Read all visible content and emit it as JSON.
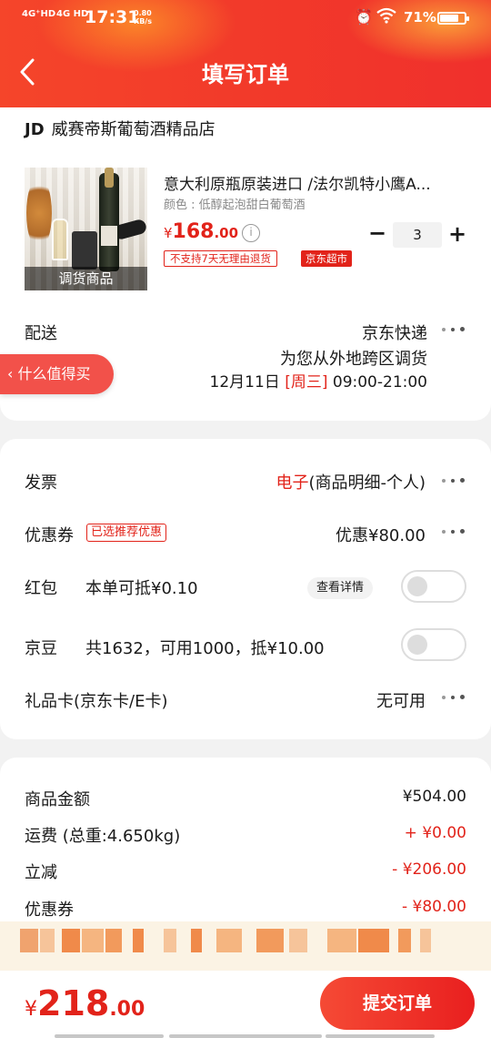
{
  "status_bar": {
    "signal1": "4G⁺HD",
    "signal2": "4G HD",
    "time": "17:31",
    "speed_value": "0.80",
    "speed_unit": "KB/s",
    "battery": "71%"
  },
  "header": {
    "title": "填写订单"
  },
  "shop": {
    "logo": "JD",
    "name": "威赛帝斯葡萄酒精品店"
  },
  "product": {
    "name": "意大利原瓶原装进口 /法尔凯特小鹰A...",
    "spec": "颜色 : 低醇起泡甜白葡萄酒",
    "image_badge": "调货商品",
    "price_currency": "¥",
    "price_int": "168",
    "price_dec": ".00",
    "info_icon": "i",
    "tag_norefund": "不支持7天无理由退货",
    "tag_super": "京东超市",
    "qty_minus": "−",
    "quantity": "3",
    "qty_plus": "+"
  },
  "delivery": {
    "label": "配送",
    "method": "京东快递",
    "note": "为您从外地跨区调货",
    "date": "12月11日 ",
    "weekday": "[周三]",
    "time_range": " 09:00-21:00"
  },
  "float_button": {
    "label": "什么值得买"
  },
  "invoice": {
    "label": "发票",
    "type": "电子",
    "detail": "(商品明细-个人)"
  },
  "coupon": {
    "label": "优惠券",
    "tag": "已选推荐优惠",
    "value": "优惠¥80.00"
  },
  "red_packet": {
    "label": "红包",
    "text": "本单可抵¥0.10",
    "detail_button": "查看详情"
  },
  "jd_beans": {
    "label": "京豆",
    "text": "共1632，可用1000，抵¥10.00"
  },
  "gift_card": {
    "label": "礼品卡(京东卡/E卡)",
    "value": "无可用"
  },
  "summary": {
    "goods_label": "商品金额",
    "goods_value": "¥504.00",
    "shipping_label": "运费 (总重:4.650kg)",
    "shipping_value": "+ ¥0.00",
    "discount_label": "立减",
    "discount_value": "- ¥206.00",
    "coupon_label": "优惠券",
    "coupon_value": "- ¥80.00"
  },
  "footer": {
    "total_currency": "¥",
    "total_int": "218",
    "total_dec": ".00",
    "submit_label": "提交订单"
  },
  "colors": {
    "brand_red": "#e2231a",
    "header_gradient_start": "#f5452a",
    "header_gradient_end": "#f0302c"
  }
}
